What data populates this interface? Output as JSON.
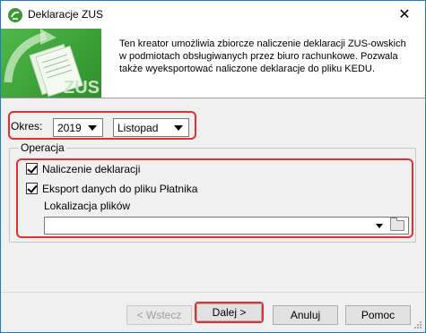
{
  "window": {
    "title": "Deklaracje ZUS",
    "close_symbol": "✕"
  },
  "banner": {
    "description": "Ten kreator umożliwia zbiorcze naliczenie deklaracji ZUS-owskich w podmiotach obsługiwanych przez biuro rachunkowe. Pozwala także wyeksportować naliczone deklaracje do pliku KEDU.",
    "image_text": "ZUS"
  },
  "okres": {
    "label": "Okres:",
    "year": "2019",
    "month": "Listopad"
  },
  "operacja": {
    "legend": "Operacja",
    "naliczenie_label": "Naliczenie deklaracji",
    "naliczenie_checked": true,
    "eksport_label": "Eksport danych do pliku Płatnika",
    "eksport_checked": true,
    "lokalizacja_label": "Lokalizacja plików",
    "lokalizacja_value": ""
  },
  "buttons": {
    "back": "< Wstecz",
    "next": "Dalej >",
    "cancel": "Anuluj",
    "help": "Pomoc"
  },
  "colors": {
    "highlight": "#e03030",
    "banner_green": "#3a9a2f",
    "window_border": "#1e7bd2"
  },
  "icons": [
    "app-logo-icon",
    "close-icon",
    "zus-banner-image",
    "dropdown-arrow-icon",
    "folder-icon",
    "checkmark-icon",
    "resize-grip-icon"
  ]
}
